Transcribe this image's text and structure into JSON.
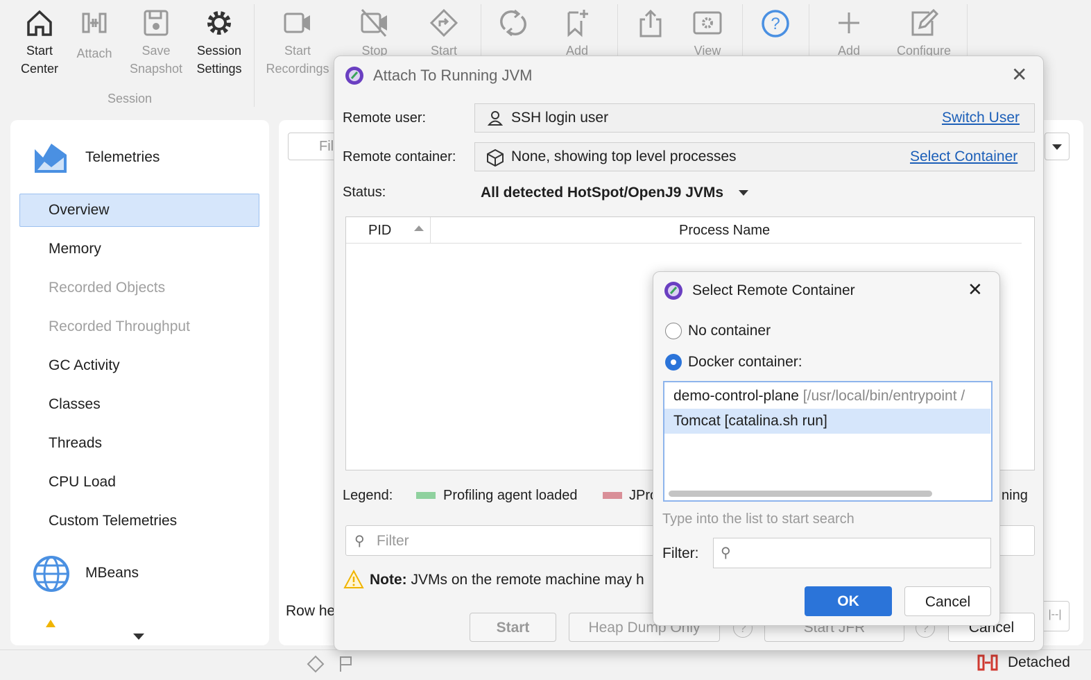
{
  "toolbar": {
    "start_center": "Start\nCenter",
    "attach": "Attach",
    "save_snapshot": "Save\nSnapshot",
    "session_settings": "Session\nSettings",
    "group_session": "Session",
    "start_recordings": "Start\nRecordings",
    "stop": "Stop",
    "start": "Start",
    "add": "Add",
    "view": "View",
    "add2": "Add",
    "configure": "Configure"
  },
  "sidebar": {
    "section1": "Telemetries",
    "items": [
      {
        "label": "Overview",
        "selected": true
      },
      {
        "label": "Memory"
      },
      {
        "label": "Recorded Objects",
        "disabled": true
      },
      {
        "label": "Recorded Throughput",
        "disabled": true
      },
      {
        "label": "GC Activity"
      },
      {
        "label": "Classes"
      },
      {
        "label": "Threads"
      },
      {
        "label": "CPU Load"
      },
      {
        "label": "Custom Telemetries"
      }
    ],
    "section2": "MBeans"
  },
  "main": {
    "filter_placeholder": "Fil",
    "row_label": "Row he"
  },
  "attach_dialog": {
    "title": "Attach To Running JVM",
    "remote_user_label": "Remote user:",
    "remote_user_value": "SSH login user",
    "switch_user": "Switch User",
    "remote_container_label": "Remote container:",
    "remote_container_value": "None, showing top level processes",
    "select_container": "Select Container",
    "status_label": "Status:",
    "status_value": "All detected HotSpot/OpenJ9 JVMs",
    "columns": [
      "PID",
      "Process Name"
    ],
    "legend_label": "Legend:",
    "legend_items": [
      {
        "label": "Profiling agent loaded",
        "color": "#8fd19e"
      },
      {
        "label": "JPro",
        "color": "#d98f98"
      }
    ],
    "legend_tail": "ning",
    "filter_placeholder": "Filter",
    "note_bold": "Note:",
    "note_text": "JVMs on the remote machine may h",
    "buttons": {
      "start": "Start",
      "heap_dump": "Heap Dump Only",
      "start_jfr": "Start JFR",
      "cancel": "Cancel"
    }
  },
  "container_dialog": {
    "title": "Select Remote Container",
    "option_none": "No container",
    "option_docker": "Docker container:",
    "selected_option": "docker",
    "containers": [
      {
        "name": "demo-control-plane",
        "cmd": "[/usr/local/bin/entrypoint /"
      },
      {
        "name": "Tomcat",
        "cmd": "[catalina.sh run]",
        "selected": true
      }
    ],
    "hint": "Type into the list to start search",
    "filter_label": "Filter:",
    "filter_value": "",
    "ok": "OK",
    "cancel": "Cancel"
  },
  "statusbar": {
    "state": "Detached"
  },
  "colors": {
    "accent": "#2b74d9",
    "selection": "#d6e6fb",
    "help": "#4a90e2",
    "detached": "#d23b32"
  }
}
